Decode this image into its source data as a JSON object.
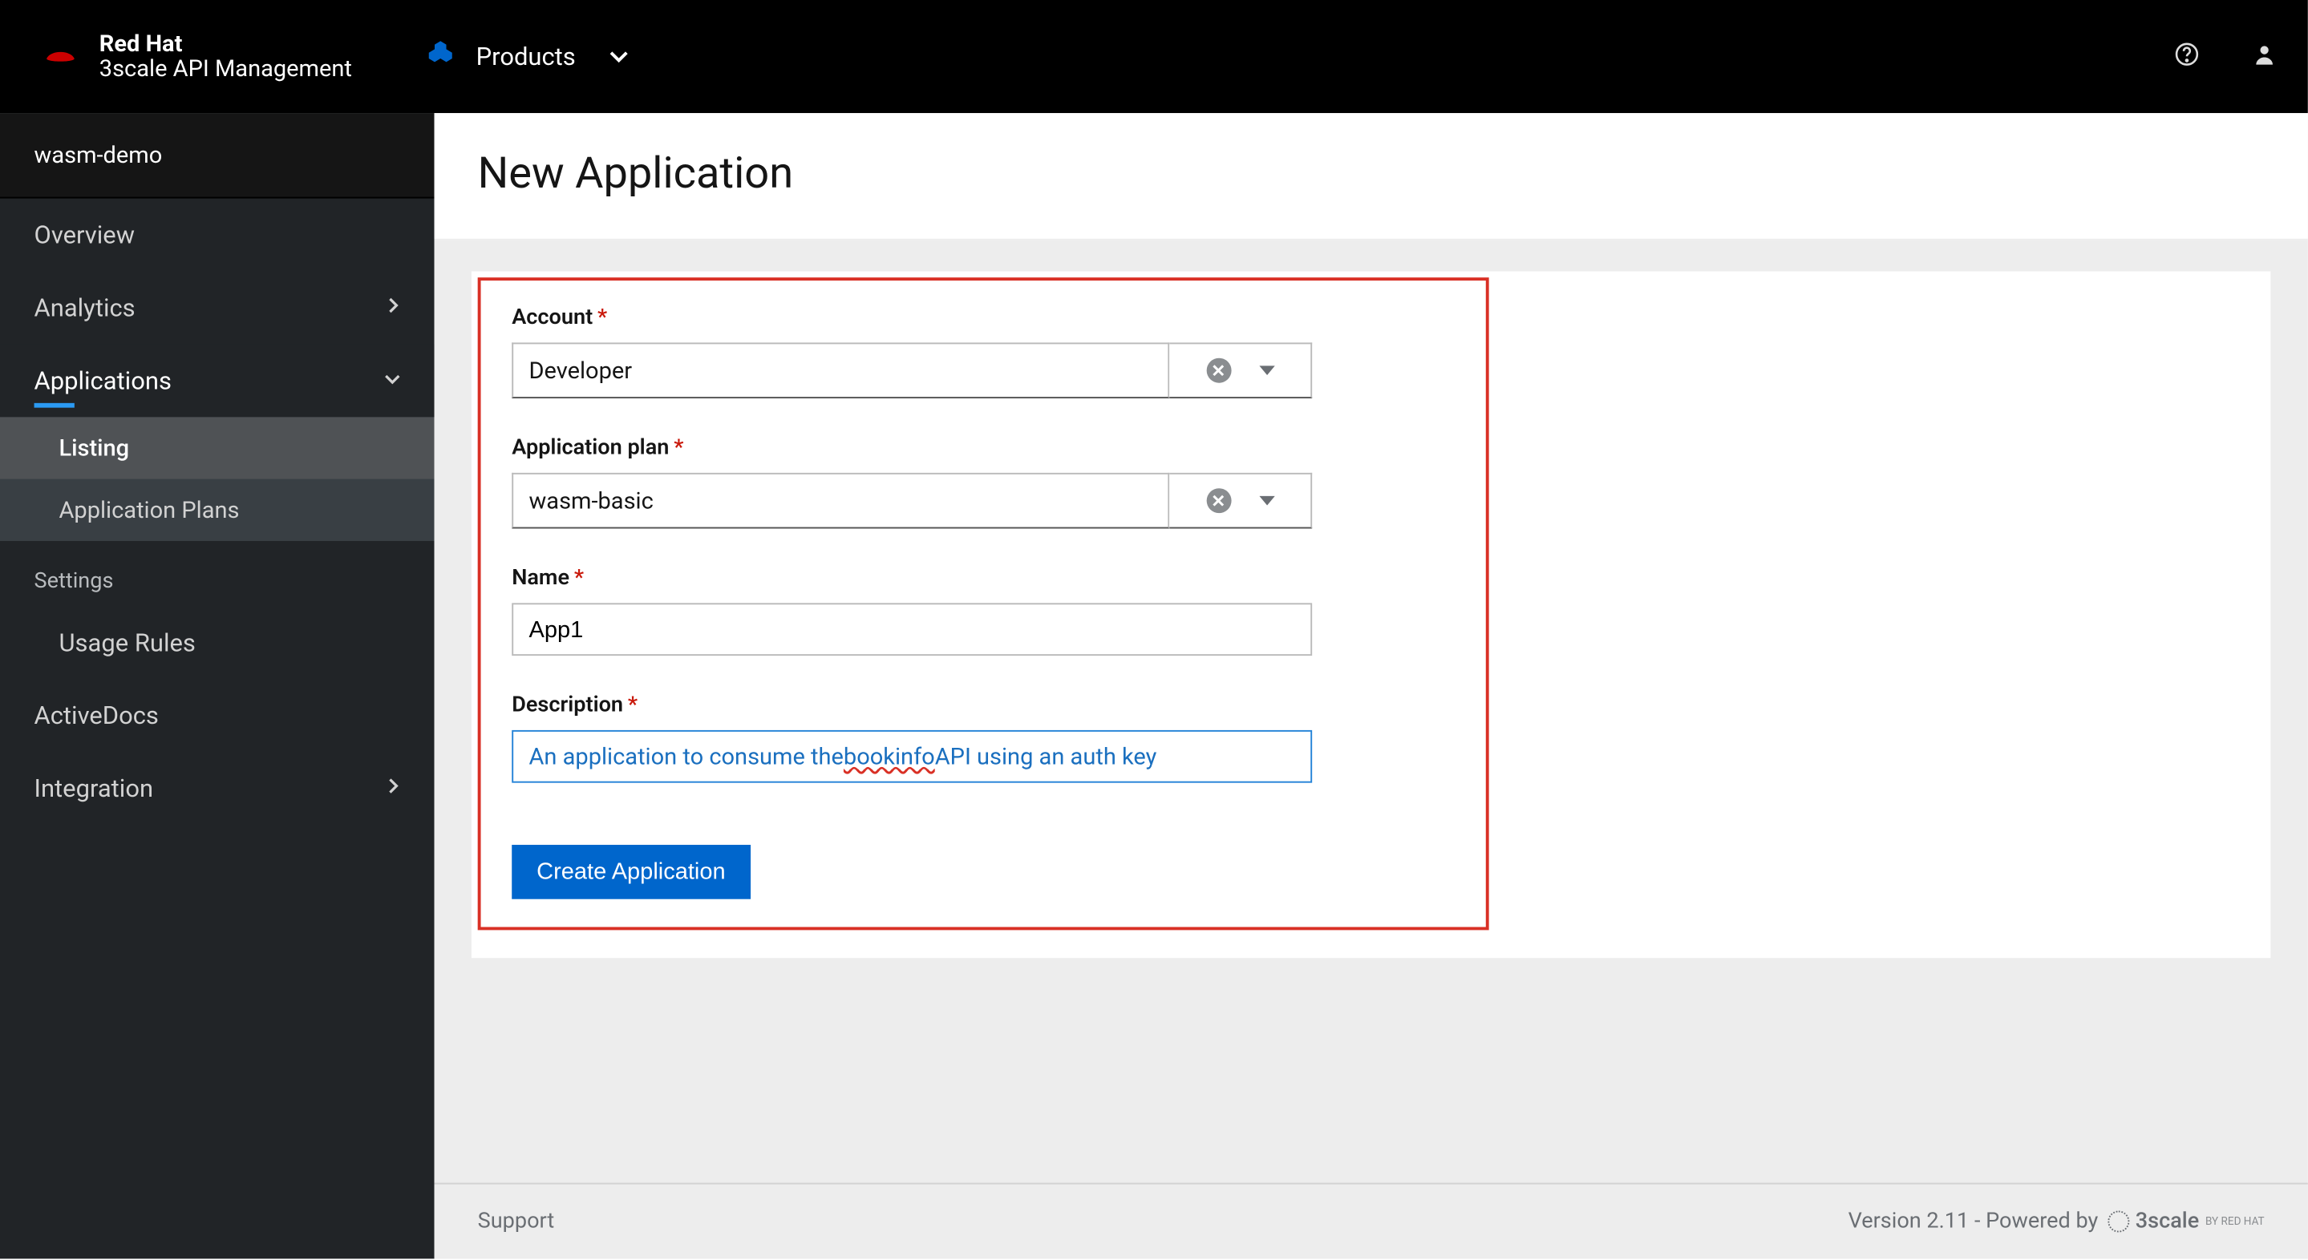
{
  "brand": {
    "line1": "Red Hat",
    "line2": "3scale API Management"
  },
  "topnav": {
    "products_label": "Products"
  },
  "sidebar": {
    "context": "wasm-demo",
    "items": {
      "overview": "Overview",
      "analytics": "Analytics",
      "applications": "Applications",
      "applications_sub": {
        "listing": "Listing",
        "plans": "Application Plans"
      },
      "settings_heading": "Settings",
      "usage_rules": "Usage Rules",
      "activedocs": "ActiveDocs",
      "integration": "Integration"
    }
  },
  "page": {
    "title": "New Application"
  },
  "form": {
    "account": {
      "label": "Account",
      "value": "Developer"
    },
    "plan": {
      "label": "Application plan",
      "value": "wasm-basic"
    },
    "name": {
      "label": "Name",
      "value": "App1"
    },
    "description": {
      "label": "Description",
      "value_pre": "An application to consume the ",
      "value_spell": "bookinfo",
      "value_post": " API using an auth key"
    },
    "submit": "Create Application"
  },
  "footer": {
    "support": "Support",
    "version": "Version 2.11 - Powered by ",
    "powered": "3scale",
    "byline": "BY RED HAT"
  }
}
